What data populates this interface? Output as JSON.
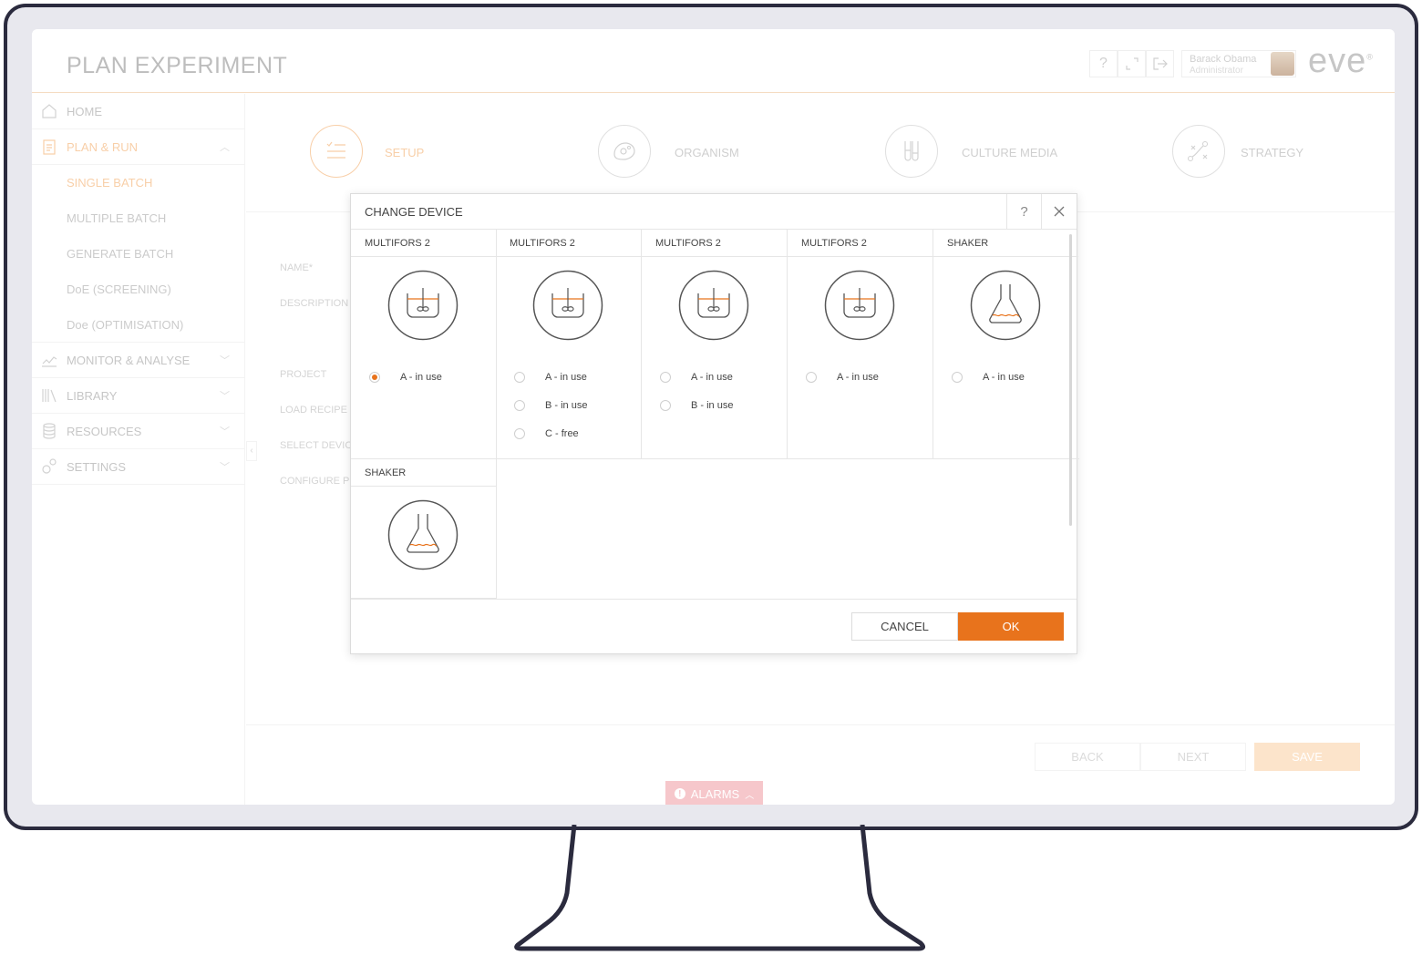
{
  "header": {
    "title": "PLAN EXPERIMENT",
    "help_label": "?",
    "user_name": "Barack Obama",
    "user_role": "Administrator",
    "brand": "eve",
    "brand_mark": "®"
  },
  "sidebar": {
    "items": [
      {
        "label": "HOME",
        "icon": "home-icon"
      },
      {
        "label": "PLAN & RUN",
        "icon": "clipboard-icon",
        "active": true
      },
      {
        "label": "MONITOR & ANALYSE",
        "icon": "chart-icon"
      },
      {
        "label": "LIBRARY",
        "icon": "books-icon"
      },
      {
        "label": "RESOURCES",
        "icon": "database-icon"
      },
      {
        "label": "SETTINGS",
        "icon": "gears-icon"
      }
    ],
    "subitems": [
      {
        "label": "SINGLE BATCH",
        "active": true
      },
      {
        "label": "MULTIPLE BATCH"
      },
      {
        "label": "GENERATE BATCH"
      },
      {
        "label": "DoE (SCREENING)"
      },
      {
        "label": "Doe (OPTIMISATION)"
      }
    ]
  },
  "steps": [
    {
      "label": "SETUP",
      "icon": "list-icon",
      "active": true
    },
    {
      "label": "ORGANISM",
      "icon": "cell-icon"
    },
    {
      "label": "CULTURE MEDIA",
      "icon": "test-tubes-icon"
    },
    {
      "label": "STRATEGY",
      "icon": "strategy-icon"
    }
  ],
  "form": {
    "labels": [
      "NAME*",
      "DESCRIPTION",
      "PROJECT",
      "LOAD RECIPE",
      "SELECT DEVIC",
      "CONFIGURE P"
    ]
  },
  "footer": {
    "back": "BACK",
    "next": "NEXT",
    "save": "SAVE",
    "alarms": "ALARMS"
  },
  "modal": {
    "title": "CHANGE DEVICE",
    "help": "?",
    "cancel": "CANCEL",
    "ok": "OK",
    "devices": [
      {
        "name": "MULTIFORS 2",
        "type": "bioreactor",
        "options": [
          {
            "label": "A - in use",
            "checked": true
          }
        ]
      },
      {
        "name": "MULTIFORS 2",
        "type": "bioreactor",
        "options": [
          {
            "label": "A - in use"
          },
          {
            "label": "B - in use"
          },
          {
            "label": "C - free"
          }
        ]
      },
      {
        "name": "MULTIFORS 2",
        "type": "bioreactor",
        "options": [
          {
            "label": "A - in use"
          },
          {
            "label": "B - in use"
          }
        ]
      },
      {
        "name": "MULTIFORS 2",
        "type": "bioreactor",
        "options": [
          {
            "label": "A - in use"
          }
        ]
      },
      {
        "name": "SHAKER",
        "type": "flask",
        "options": [
          {
            "label": "A - in use"
          }
        ]
      },
      {
        "name": "SHAKER",
        "type": "flask",
        "options": []
      }
    ]
  },
  "colors": {
    "accent": "#e8731c",
    "accent_light": "#f4b57a",
    "alarm": "#f2a9b0",
    "frame": "#2b2b3e"
  }
}
